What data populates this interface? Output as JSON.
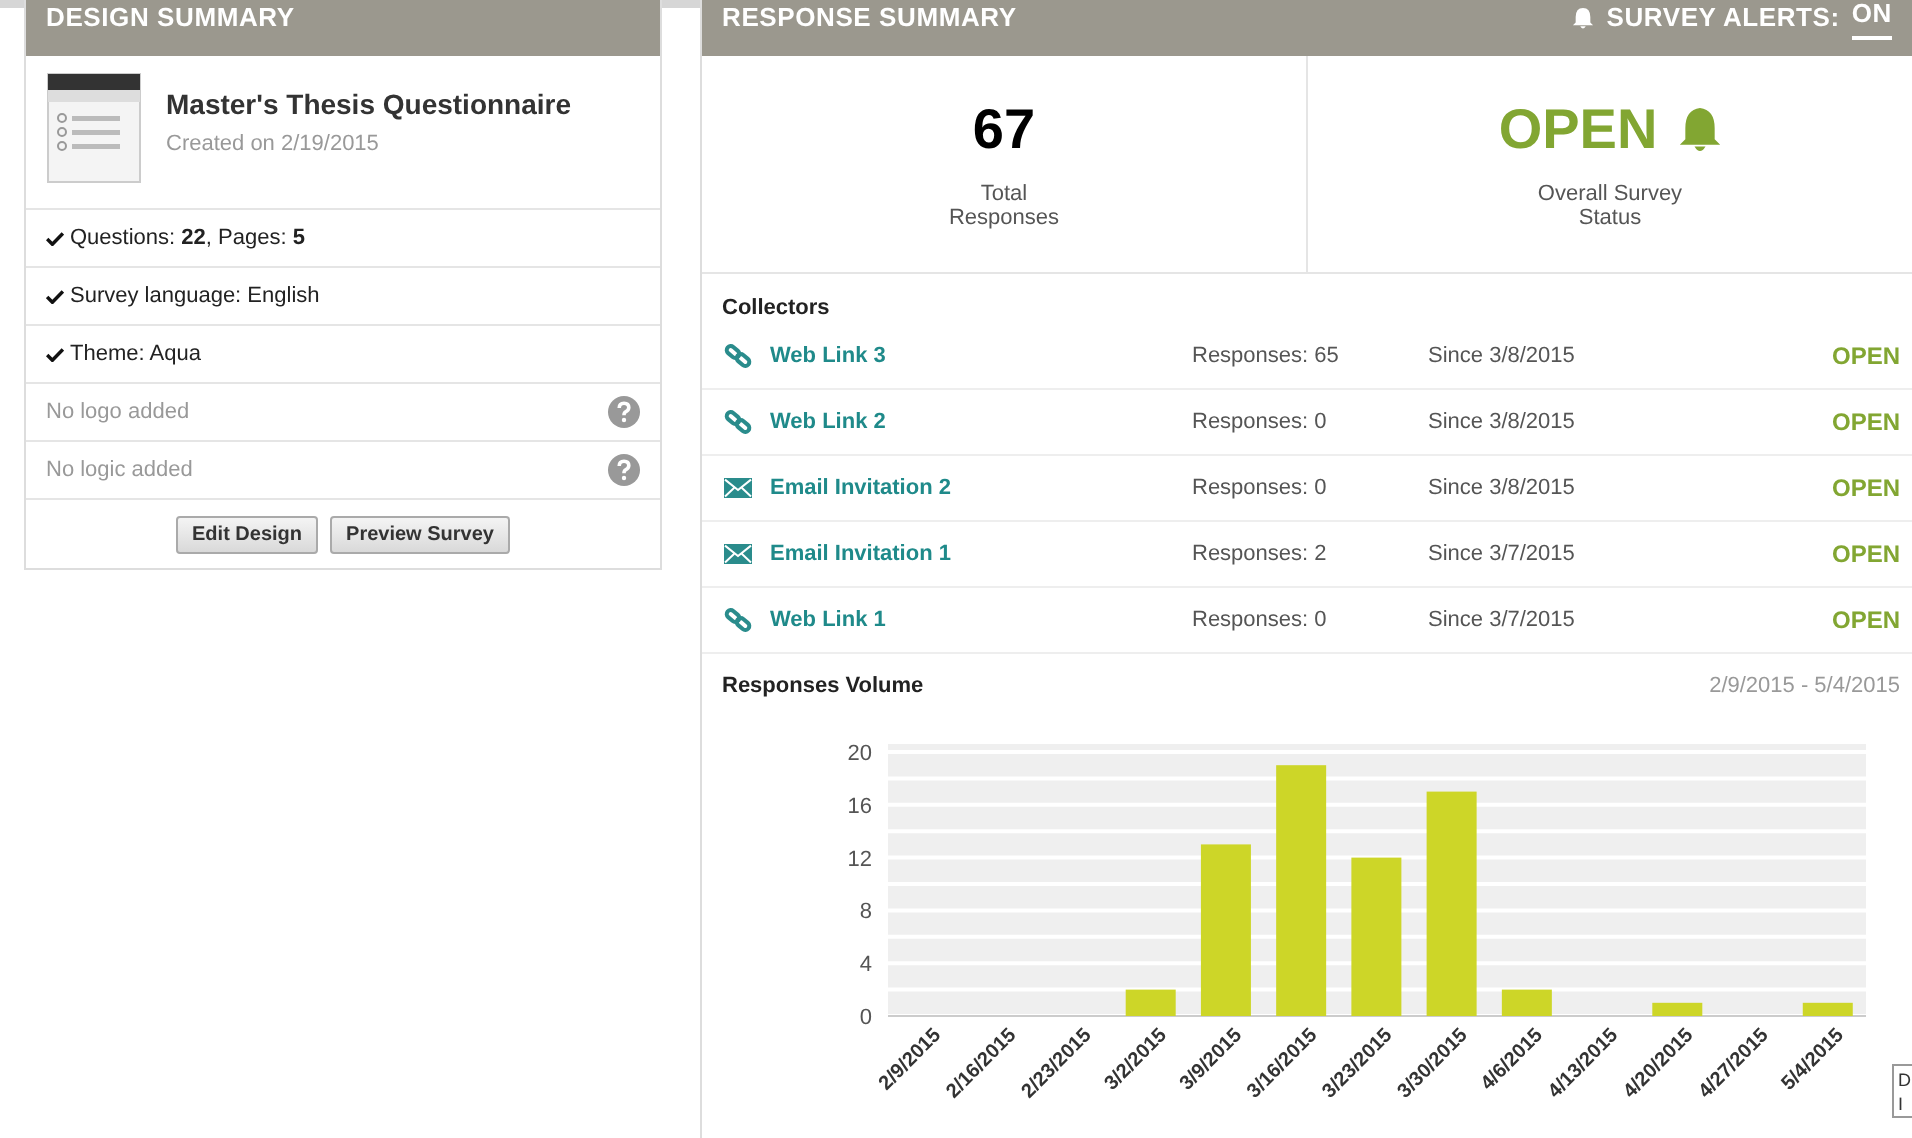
{
  "design_summary": {
    "title": "DESIGN SUMMARY",
    "survey_title": "Master's Thesis Questionnaire",
    "created": "Created on 2/19/2015",
    "items": [
      {
        "kind": "check",
        "text": "Questions: **22**, Pages: **5**"
      },
      {
        "kind": "check",
        "text": "Survey language: English"
      },
      {
        "kind": "check",
        "text": "Theme: Aqua"
      },
      {
        "kind": "help",
        "text": "No logo added"
      },
      {
        "kind": "help",
        "text": "No logic added"
      }
    ],
    "buttons": [
      "Edit Design",
      "Preview Survey"
    ]
  },
  "response_summary": {
    "title": "RESPONSE SUMMARY",
    "alerts_label": "SURVEY ALERTS:",
    "alerts_value": "ON",
    "total": "67",
    "total_label": "Total Responses",
    "status": "OPEN",
    "status_label": "Overall Survey Status",
    "collectors_title": "Collectors",
    "collectors": [
      {
        "kind": "link",
        "name": "Web Link 3",
        "responses": "Responses: 65",
        "since": "Since 3/8/2015",
        "status": "OPEN"
      },
      {
        "kind": "link",
        "name": "Web Link 2",
        "responses": "Responses: 0",
        "since": "Since 3/8/2015",
        "status": "OPEN"
      },
      {
        "kind": "email",
        "name": "Email Invitation 2",
        "responses": "Responses: 0",
        "since": "Since 3/8/2015",
        "status": "OPEN"
      },
      {
        "kind": "email",
        "name": "Email Invitation 1",
        "responses": "Responses: 2",
        "since": "Since 3/7/2015",
        "status": "OPEN"
      },
      {
        "kind": "link",
        "name": "Web Link 1",
        "responses": "Responses: 0",
        "since": "Since 3/7/2015",
        "status": "OPEN"
      }
    ],
    "volume_title": "Responses Volume",
    "volume_range": "2/9/2015 - 5/4/2015",
    "chart_data": {
      "type": "bar",
      "categories": [
        "2/9/2015",
        "2/16/2015",
        "2/23/2015",
        "3/2/2015",
        "3/9/2015",
        "3/16/2015",
        "3/23/2015",
        "3/30/2015",
        "4/6/2015",
        "4/13/2015",
        "4/20/2015",
        "4/27/2015",
        "5/4/2015"
      ],
      "series": [
        {
          "color": "#cdd628",
          "values": [
            0,
            0,
            0,
            2,
            13,
            19,
            12,
            17,
            2,
            0,
            1,
            0,
            1
          ]
        }
      ],
      "grid": true,
      "ylim": [
        0,
        20
      ],
      "yticks": [
        0,
        4,
        8,
        12,
        16,
        20
      ]
    }
  },
  "corner_note": [
    "D",
    "I"
  ]
}
